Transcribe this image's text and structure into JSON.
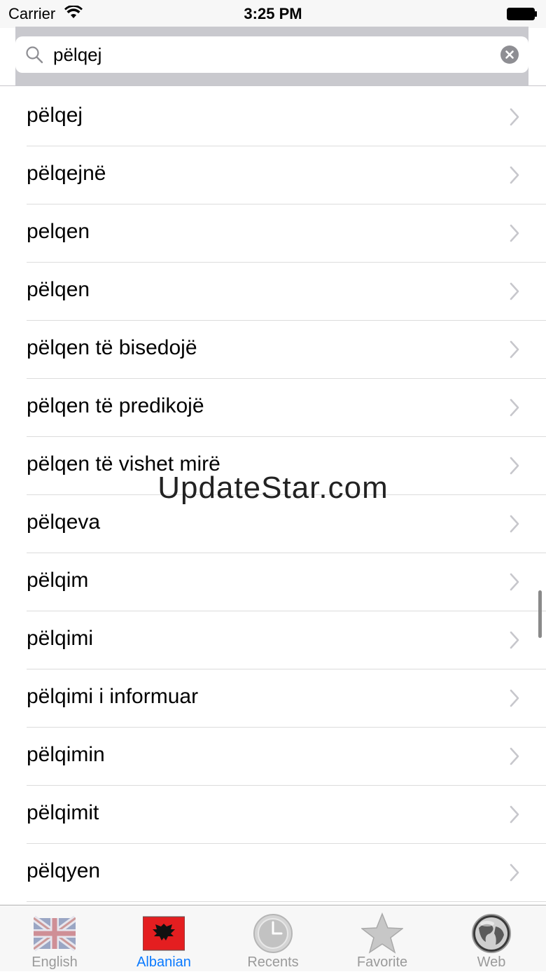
{
  "status_bar": {
    "carrier": "Carrier",
    "time": "3:25 PM"
  },
  "search": {
    "value": "pëlqej",
    "placeholder": ""
  },
  "results": [
    "pëlqej",
    "pëlqejnë",
    "pelqen",
    "pëlqen",
    "pëlqen të bisedojë",
    "pëlqen të predikojë",
    "pëlqen të vishet mirë",
    "pëlqeva",
    "pëlqim",
    "pëlqimi",
    "pëlqimi i informuar",
    "pëlqimin",
    "pëlqimit",
    "pëlqyen"
  ],
  "watermark": "UpdateStar.com",
  "tabs": [
    {
      "label": "English",
      "icon": "uk-flag-icon",
      "active": false
    },
    {
      "label": "Albanian",
      "icon": "albania-flag-icon",
      "active": true
    },
    {
      "label": "Recents",
      "icon": "clock-icon",
      "active": false
    },
    {
      "label": "Favorite",
      "icon": "star-icon",
      "active": false
    },
    {
      "label": "Web",
      "icon": "globe-icon",
      "active": false
    }
  ],
  "colors": {
    "accent": "#0a7aff",
    "tab_inactive": "#9a9a9a",
    "search_bar_bg": "#c9c9ce"
  }
}
